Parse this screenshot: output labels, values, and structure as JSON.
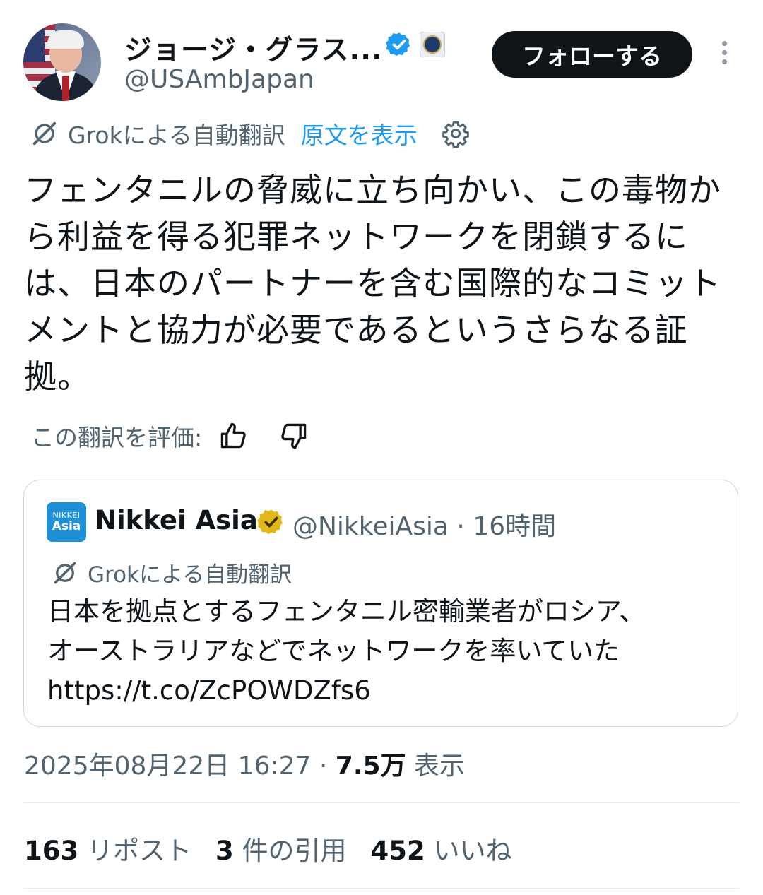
{
  "author": {
    "name": "ジョージ・グラス...",
    "handle": "@USAmbJapan"
  },
  "follow_button": "フォローする",
  "translation": {
    "source_label": "Grokによる自動翻訳",
    "show_original": "原文を表示"
  },
  "tweet_text": "フェンタニルの脅威に立ち向かい、この毒物から利益を得る犯罪ネットワークを閉鎖するには、日本のパートナーを含む国際的なコミットメントと協力が必要であるというさらなる証拠。",
  "rating": {
    "label": "この翻訳を評価:"
  },
  "quote": {
    "logo_line1": "NIKKEI",
    "logo_line2": "Asia",
    "name": "Nikkei Asia",
    "handle": "@NikkeiAsia",
    "time": "16時間",
    "separator": "·",
    "translation_label": "Grokによる自動翻訳",
    "text_line1": "日本を拠点とするフェンタニル密輸業者がロシア、",
    "text_line2": "オーストラリアなどでネットワークを率いていた",
    "link": "https://t.co/ZcPOWDZfs6"
  },
  "meta": {
    "datetime": "2025年08月22日 16:27",
    "separator": "·",
    "views": "7.5万",
    "views_label": "表示"
  },
  "stats": {
    "reposts": "163",
    "reposts_label": "リポスト",
    "quotes": "3",
    "quotes_label": "件の引用",
    "likes": "452",
    "likes_label": "いいね"
  },
  "colors": {
    "link": "#1d9bf0",
    "verified_blue": "#1d9bf0",
    "verified_gold": "#e2b719",
    "secondary_text": "#536471"
  }
}
